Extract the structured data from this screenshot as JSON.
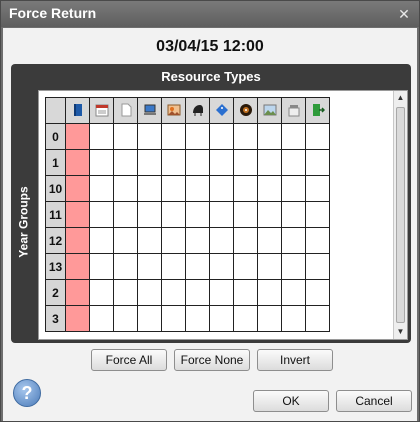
{
  "window": {
    "title": "Force Return"
  },
  "datetime": "03/04/15 12:00",
  "panel": {
    "title": "Resource Types",
    "ylabel": "Year Groups",
    "columns": [
      {
        "icon": "book-icon"
      },
      {
        "icon": "calendar-icon"
      },
      {
        "icon": "document-icon"
      },
      {
        "icon": "laptop-icon"
      },
      {
        "icon": "photo-icon"
      },
      {
        "icon": "piano-icon"
      },
      {
        "icon": "tag-icon"
      },
      {
        "icon": "disc-icon"
      },
      {
        "icon": "landscape-icon"
      },
      {
        "icon": "jar-icon"
      },
      {
        "icon": "exit-icon"
      }
    ],
    "rows": [
      "0",
      "1",
      "10",
      "11",
      "12",
      "13",
      "2",
      "3"
    ]
  },
  "buttons": {
    "force_all": "Force All",
    "force_none": "Force None",
    "invert": "Invert",
    "ok": "OK",
    "cancel": "Cancel"
  },
  "colors": {
    "selected_cell": "#ff9999",
    "panel_bg": "#3b3b3b"
  }
}
